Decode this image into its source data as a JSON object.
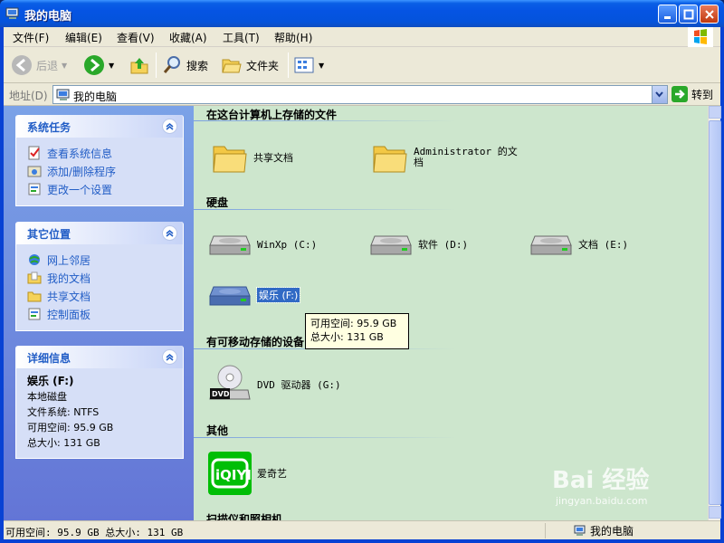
{
  "window": {
    "title": "我的电脑"
  },
  "menu": [
    "文件(F)",
    "编辑(E)",
    "查看(V)",
    "收藏(A)",
    "工具(T)",
    "帮助(H)"
  ],
  "toolbar": {
    "back": "后退",
    "search": "搜索",
    "folders": "文件夹"
  },
  "address": {
    "label": "地址(D)",
    "value": "我的电脑",
    "go": "转到"
  },
  "left": {
    "system_tasks": {
      "title": "系统任务",
      "items": [
        "查看系统信息",
        "添加/删除程序",
        "更改一个设置"
      ]
    },
    "other_places": {
      "title": "其它位置",
      "items": [
        "网上邻居",
        "我的文档",
        "共享文档",
        "控制面板"
      ]
    },
    "details": {
      "title": "详细信息",
      "name": "娱乐 (F:)",
      "type": "本地磁盘",
      "fs": "文件系统: NTFS",
      "free": "可用空间: 95.9 GB",
      "total": "总大小: 131 GB"
    }
  },
  "groups": {
    "files": {
      "title": "在这台计算机上存储的文件",
      "items": [
        "共享文档",
        "Administrator 的文档"
      ]
    },
    "hdd": {
      "title": "硬盘",
      "items": [
        "WinXp (C:)",
        "软件 (D:)",
        "文档 (E:)",
        "娱乐 (F:)"
      ]
    },
    "removable": {
      "title": "有可移动存储的设备",
      "items": [
        "DVD 驱动器 (G:)"
      ]
    },
    "other": {
      "title": "其他",
      "items": [
        "爱奇艺"
      ]
    },
    "scanners": {
      "title": "扫描仪和照相机"
    }
  },
  "tooltip": {
    "line1": "可用空间: 95.9 GB",
    "line2": "总大小: 131 GB"
  },
  "status": {
    "left": "可用空间: 95.9 GB 总大小: 131 GB",
    "right": "我的电脑"
  },
  "watermark": {
    "brand": "Bai 经验",
    "url": "jingyan.baidu.com"
  },
  "colors": {
    "title_bar": "#0554e3",
    "content_bg": "#cde6cd",
    "task_link": "#215dc6"
  }
}
